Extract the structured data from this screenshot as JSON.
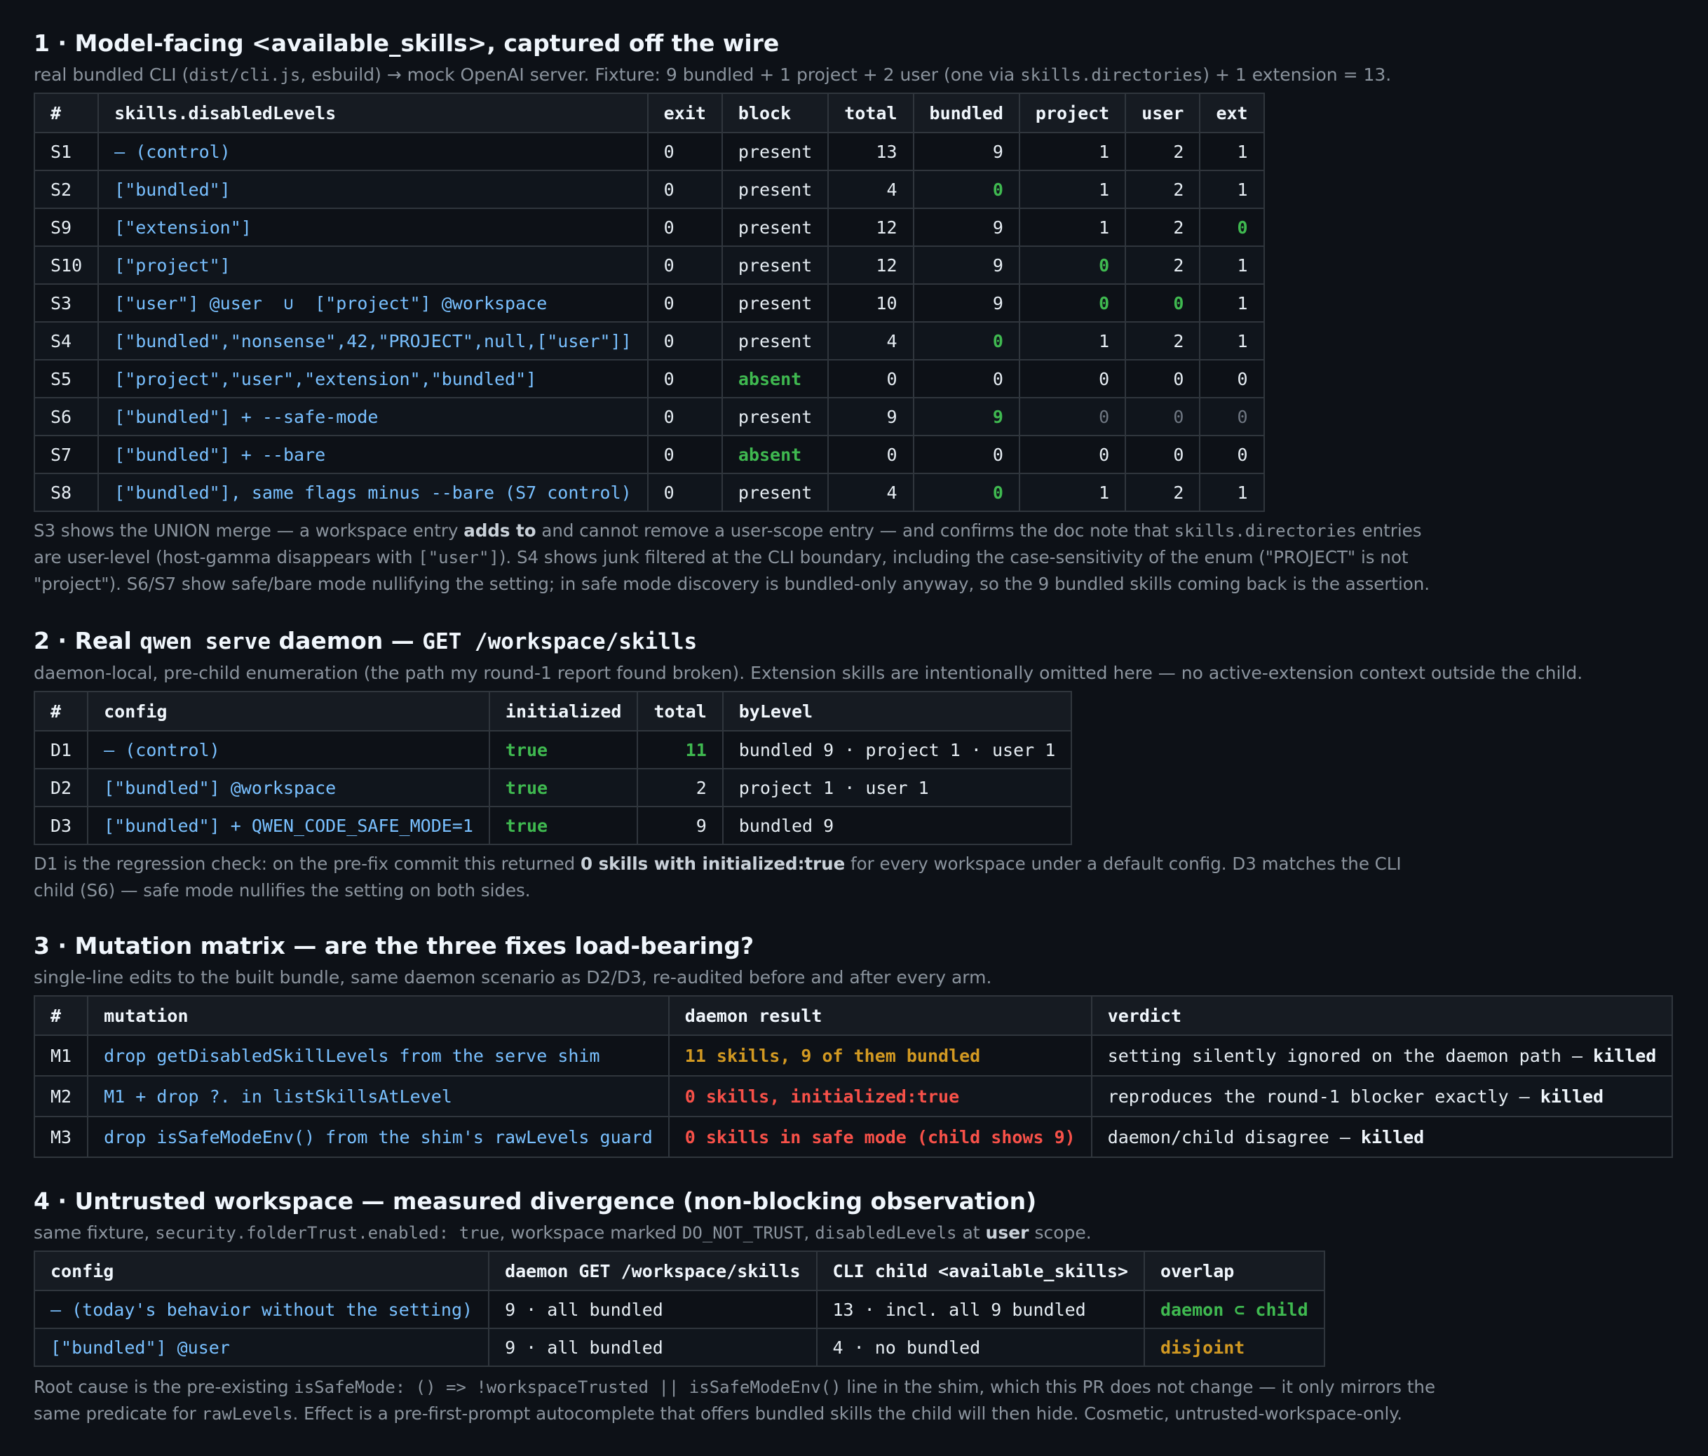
{
  "s1": {
    "title": "1 · Model-facing <available_skills>, captured off the wire",
    "sub": {
      "a": "real bundled CLI (",
      "b": "dist/cli.js",
      "c": ", esbuild) → mock OpenAI server. Fixture: 9 bundled + 1 project + 2 user (one via ",
      "d": "skills.directories",
      "e": ") + 1 extension = 13."
    },
    "headers": [
      "#",
      "skills.disabledLevels",
      "exit",
      "block",
      "total",
      "bundled",
      "project",
      "user",
      "ext"
    ],
    "rows": [
      [
        "S1",
        "– (control)",
        "0",
        "present",
        "13",
        "9",
        "1",
        "2",
        "1"
      ],
      [
        "S2",
        "[\"bundled\"]",
        "0",
        "present",
        "4",
        "0",
        "1",
        "2",
        "1"
      ],
      [
        "S9",
        "[\"extension\"]",
        "0",
        "present",
        "12",
        "9",
        "1",
        "2",
        "0"
      ],
      [
        "S10",
        "[\"project\"]",
        "0",
        "present",
        "12",
        "9",
        "0",
        "2",
        "1"
      ],
      [
        "S3",
        "[\"user\"] @user  ∪  [\"project\"] @workspace",
        "0",
        "present",
        "10",
        "9",
        "0",
        "0",
        "1"
      ],
      [
        "S4",
        "[\"bundled\",\"nonsense\",42,\"PROJECT\",null,[\"user\"]]",
        "0",
        "present",
        "4",
        "0",
        "1",
        "2",
        "1"
      ],
      [
        "S5",
        "[\"project\",\"user\",\"extension\",\"bundled\"]",
        "0",
        "absent",
        "0",
        "0",
        "0",
        "0",
        "0"
      ],
      [
        "S6",
        "[\"bundled\"] + --safe-mode",
        "0",
        "present",
        "9",
        "9",
        "0",
        "0",
        "0"
      ],
      [
        "S7",
        "[\"bundled\"] + --bare",
        "0",
        "absent",
        "0",
        "0",
        "0",
        "0",
        "0"
      ],
      [
        "S8",
        "[\"bundled\"], same flags minus --bare (S7 control)",
        "0",
        "present",
        "4",
        "0",
        "1",
        "2",
        "1"
      ]
    ],
    "note": {
      "a": "S3 shows the UNION merge — a workspace entry ",
      "b": "adds to",
      "c": " and cannot remove a user-scope entry — and confirms the doc note that ",
      "d": "skills.directories",
      "e": " entries are user-level (host-gamma disappears with ",
      "f": "[\"user\"]",
      "g": "). S4 shows junk filtered at the CLI boundary, including the case-sensitivity of the enum (\"PROJECT\" is not \"project\"). S6/S7 show safe/bare mode nullifying the setting; in safe mode discovery is bundled-only anyway, so the 9 bundled skills coming back is the assertion."
    }
  },
  "s2": {
    "title": {
      "a": "2 · Real ",
      "b": "qwen serve",
      "c": " daemon — ",
      "d": "GET /workspace/skills"
    },
    "sub": "daemon-local, pre-child enumeration (the path my round-1 report found broken). Extension skills are intentionally omitted here — no active-extension context outside the child.",
    "headers": [
      "#",
      "config",
      "initialized",
      "total",
      "byLevel"
    ],
    "rows": [
      [
        "D1",
        "– (control)",
        "true",
        "11",
        "bundled 9 · project 1 · user 1"
      ],
      [
        "D2",
        "[\"bundled\"] @workspace",
        "true",
        "2",
        "project 1 · user 1"
      ],
      [
        "D3",
        "[\"bundled\"] + QWEN_CODE_SAFE_MODE=1",
        "true",
        "9",
        "bundled 9"
      ]
    ],
    "note": {
      "a": "D1 is the regression check: on the pre-fix commit this returned ",
      "b": "0 skills with initialized:true",
      "c": " for every workspace under a default config. D3 matches the CLI child (S6) — safe mode nullifies the setting on both sides."
    }
  },
  "s3": {
    "title": "3 · Mutation matrix — are the three fixes load-bearing?",
    "sub": "single-line edits to the built bundle, same daemon scenario as D2/D3, re-audited before and after every arm.",
    "headers": [
      "#",
      "mutation",
      "daemon result",
      "verdict"
    ],
    "rows": [
      {
        "id": "M1",
        "mutation": "drop getDisabledSkillLevels from the serve shim",
        "result": "11 skills, 9 of them bundled",
        "verdict": "setting silently ignored on the daemon path – ",
        "verdict_bold": "killed"
      },
      {
        "id": "M2",
        "mutation": "M1 + drop ?. in listSkillsAtLevel",
        "result": "0 skills, initialized:true",
        "verdict": "reproduces the round-1 blocker exactly – ",
        "verdict_bold": "killed"
      },
      {
        "id": "M3",
        "mutation": "drop isSafeModeEnv() from the shim's rawLevels guard",
        "result": "0 skills in safe mode (child shows 9)",
        "verdict": "daemon/child disagree – ",
        "verdict_bold": "killed"
      }
    ]
  },
  "s4": {
    "title": "4 · Untrusted workspace — measured divergence (non-blocking observation)",
    "sub": {
      "a": "same fixture, ",
      "b": "security.folderTrust.enabled: true",
      "c": ", workspace marked ",
      "d": "DO_NOT_TRUST",
      "e": ", ",
      "f": "disabledLevels",
      "g": " at ",
      "h": "user",
      "i": " scope."
    },
    "headers": [
      "config",
      "daemon GET /workspace/skills",
      "CLI child <available_skills>",
      "overlap"
    ],
    "rows": [
      [
        "– (today's behavior without the setting)",
        "9 · all bundled",
        "13 · incl. all 9 bundled",
        "daemon ⊂ child"
      ],
      [
        "[\"bundled\"] @user",
        "9 · all bundled",
        "4 · no bundled",
        "disjoint"
      ]
    ],
    "note": {
      "a": "Root cause is the pre-existing ",
      "b": "isSafeMode: () => !workspaceTrusted || isSafeModeEnv()",
      "c": " line in the shim, which this PR does not change — it only mirrors the same predicate for ",
      "d": "rawLevels",
      "e": ". Effect is a pre-first-prompt autocomplete that offers bundled skills the child will then hide. Cosmetic, untrusted-workspace-only."
    }
  }
}
